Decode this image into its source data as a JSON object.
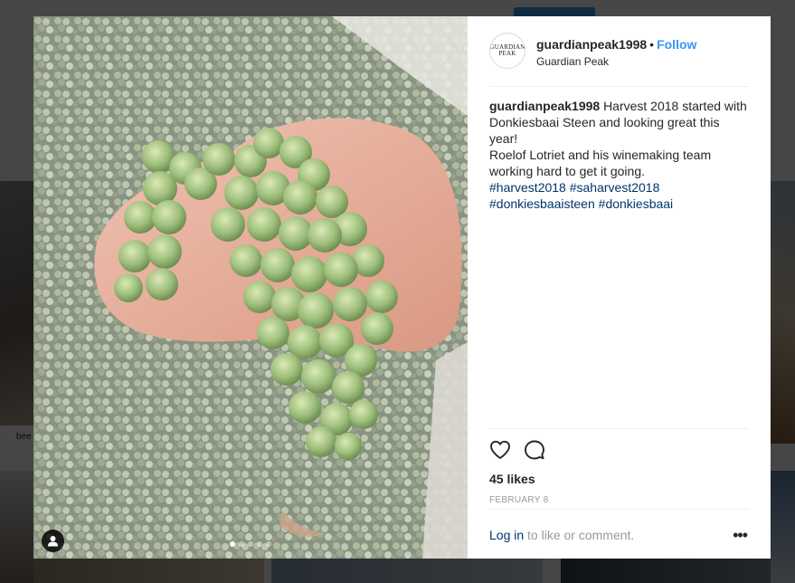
{
  "background": {
    "user_fragment": "bee"
  },
  "post": {
    "username": "guardianpeak1998",
    "separator": "•",
    "follow_label": "Follow",
    "location": "Guardian Peak",
    "avatar_logo_top": "GUARDIAN",
    "avatar_logo_bottom": "PEAK",
    "caption": {
      "username": "guardianpeak1998",
      "line1": "Harvest 2018 started with",
      "line2": "Donkiesbaai Steen and looking great this",
      "line3": "year!",
      "line4": "Roelof Lotriet and his winemaking team",
      "line5": "working hard to get it going.",
      "hashtags": [
        "#harvest2018",
        "#saharvest2018",
        "#donkiesbaaisteen",
        "#donkiesbaai"
      ]
    },
    "likes": "45 likes",
    "date": "FEBRUARY 8",
    "carousel": {
      "count": 5,
      "active_index": 0
    },
    "icons": {
      "like": "heart-icon",
      "comment": "comment-icon",
      "tag": "user-tag-icon",
      "more": "more-options-icon"
    }
  },
  "comment_bar": {
    "login_label": "Log in",
    "prompt": "to like or comment.",
    "more": "•••"
  },
  "colors": {
    "accent": "#3897f0",
    "link": "#003569",
    "muted": "#999999",
    "text": "#262626"
  }
}
